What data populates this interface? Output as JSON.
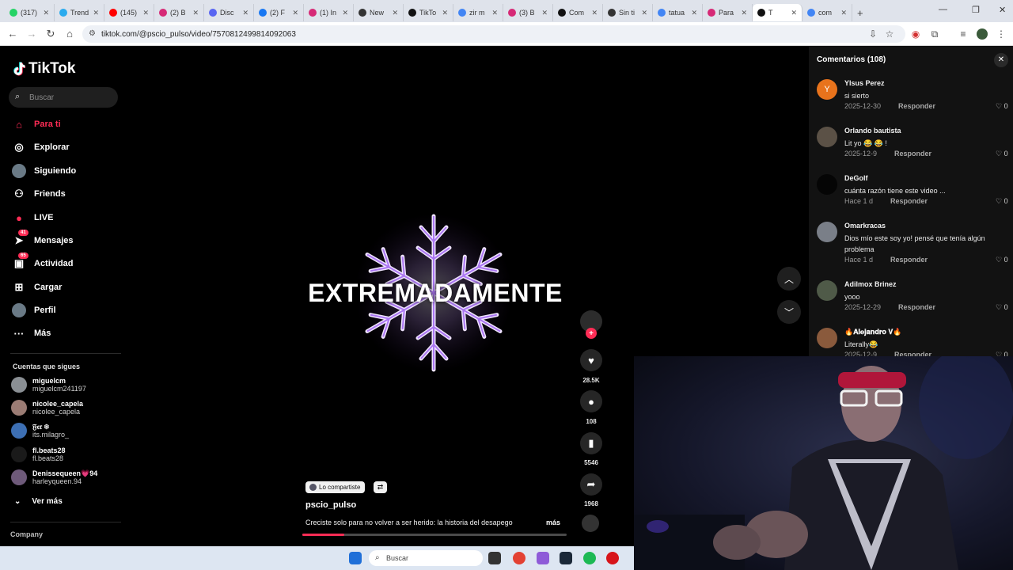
{
  "browser": {
    "tabs": [
      {
        "title": "(317)",
        "color": "#25d366"
      },
      {
        "title": "Trend",
        "color": "#2aabee"
      },
      {
        "title": "(145)",
        "color": "#ff0000"
      },
      {
        "title": "(2) B",
        "color": "#d62976"
      },
      {
        "title": "Disc",
        "color": "#5865f2"
      },
      {
        "title": "(2) F",
        "color": "#1877f2"
      },
      {
        "title": "(1) In",
        "color": "#d62976"
      },
      {
        "title": "New",
        "color": "#333333"
      },
      {
        "title": "TikTo",
        "color": "#111111"
      },
      {
        "title": "zir m",
        "color": "#4285f4"
      },
      {
        "title": "(3) B",
        "color": "#d62976"
      },
      {
        "title": "Com",
        "color": "#111111"
      },
      {
        "title": "Sin ti",
        "color": "#333333"
      },
      {
        "title": "tatua",
        "color": "#4285f4"
      },
      {
        "title": "Para",
        "color": "#d62976"
      },
      {
        "title": "T",
        "color": "#111111"
      },
      {
        "title": "com",
        "color": "#4285f4"
      }
    ],
    "active_tab_index": 15,
    "url": "tiktok.com/@pscio_pulso/video/7570812499814092063"
  },
  "sidebar": {
    "logo": "TikTok",
    "search_placeholder": "Buscar",
    "nav": [
      {
        "label": "Para ti",
        "icon": "home-icon"
      },
      {
        "label": "Explorar",
        "icon": "compass-icon"
      },
      {
        "label": "Siguiendo",
        "icon": "following-avatar"
      },
      {
        "label": "Friends",
        "icon": "friends-icon"
      },
      {
        "label": "LIVE",
        "icon": "live-icon"
      },
      {
        "label": "Mensajes",
        "icon": "messages-icon",
        "badge": "41"
      },
      {
        "label": "Actividad",
        "icon": "activity-icon",
        "badge": "65"
      },
      {
        "label": "Cargar",
        "icon": "upload-icon"
      },
      {
        "label": "Perfil",
        "icon": "profile-avatar"
      },
      {
        "label": "Más",
        "icon": "more-icon"
      }
    ],
    "following_title": "Cuentas que sigues",
    "following": [
      {
        "name": "miguelcm",
        "handle": "miguelcm241197",
        "color": "#8a8f94"
      },
      {
        "name": "nicolee_capela",
        "handle": "nicolee_capela",
        "color": "#9b7c74"
      },
      {
        "name": "𝔉𝔢𝔯 ❄",
        "handle": "its.milagro_",
        "color": "#3d6fb3"
      },
      {
        "name": "fl.beats28",
        "handle": "fl.beats28",
        "color": "#1a1a1a"
      },
      {
        "name": "Denissequeen💗94",
        "handle": "harleyqueen.94",
        "color": "#6e5a7a"
      }
    ],
    "see_more": "Ver más",
    "company": "Company"
  },
  "video": {
    "overlay_text": "EXTREMADAMENTE",
    "shared_label": "Lo compartiste",
    "author": "pscio_pulso",
    "description": "Creciste solo para no volver a ser herido: la historia del desapego",
    "more": "más",
    "progress": 0.16,
    "actions": {
      "likes": "28.5K",
      "comments": "108",
      "saves": "5546",
      "shares": "1968"
    }
  },
  "comments": {
    "title": "Comentarios (108)",
    "items": [
      {
        "user": "Ylsus Perez",
        "text": "si sierto",
        "date": "2025-12-30",
        "reply": "Responder",
        "likes": "0",
        "avatar_color": "#e8731c",
        "avatar_letter": "Y"
      },
      {
        "user": "Orlando bautista",
        "text": "Lit yo 😂 😂 !",
        "date": "2025-12-9",
        "reply": "Responder",
        "likes": "0",
        "avatar_color": "#5b5146",
        "avatar_letter": ""
      },
      {
        "user": "DeGolf",
        "text": "cuánta razón tiene este video ...",
        "date": "Hace 1 d",
        "reply": "Responder",
        "likes": "0",
        "avatar_color": "#050505",
        "avatar_letter": ""
      },
      {
        "user": "Omarkracas",
        "text": "Dios mío este soy yo! pensé que tenía algún problema",
        "date": "Hace 1 d",
        "reply": "Responder",
        "likes": "0",
        "avatar_color": "#7a7f88",
        "avatar_letter": ""
      },
      {
        "user": "Adilmox Brinez",
        "text": "yooo",
        "date": "2025-12-29",
        "reply": "Responder",
        "likes": "0",
        "avatar_color": "#4f5a48",
        "avatar_letter": ""
      },
      {
        "user": "🔥𝐀𝐥𝐞𝐣𝐚𝐧𝐝𝐫𝐨 𝐕🔥",
        "text": "Literally😂",
        "date": "2025-12-9",
        "reply": "Responder",
        "likes": "0",
        "avatar_color": "#8a5a3c",
        "avatar_letter": ""
      }
    ]
  },
  "taskbar": {
    "search_placeholder": "Buscar"
  },
  "colors": {
    "accent": "#fe2c55",
    "background": "#000000",
    "panel": "#121212"
  }
}
